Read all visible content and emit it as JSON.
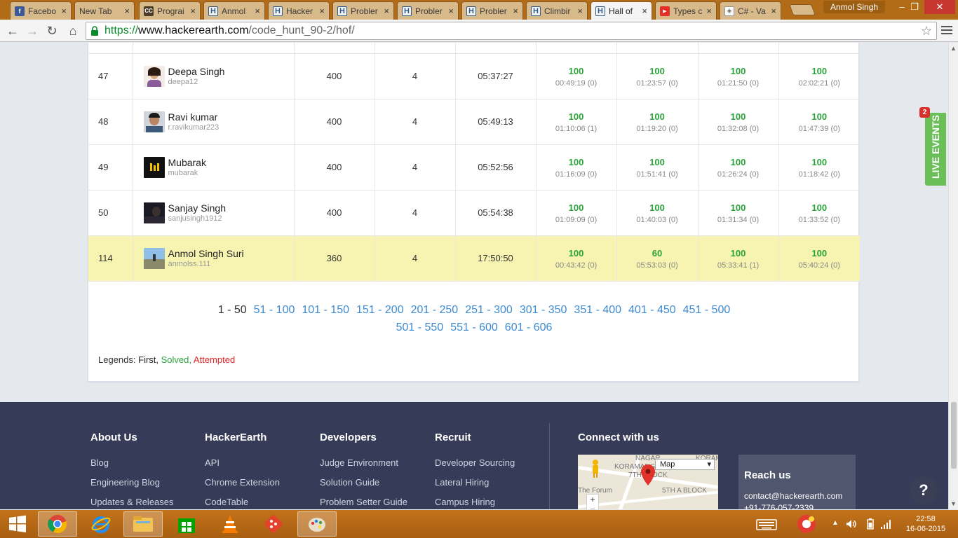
{
  "browser": {
    "tabs": [
      {
        "title": "Facebo",
        "favicon": "facebook-icon",
        "active": false
      },
      {
        "title": "New Tab",
        "favicon": "none",
        "active": false
      },
      {
        "title": "Prograi",
        "favicon": "cc-icon",
        "active": false
      },
      {
        "title": "Anmol",
        "favicon": "hackerearth-icon",
        "active": false
      },
      {
        "title": "Hacker",
        "favicon": "hackerearth-icon",
        "active": false
      },
      {
        "title": "Probler",
        "favicon": "hackerearth-icon",
        "active": false
      },
      {
        "title": "Probler",
        "favicon": "hackerearth-icon",
        "active": false
      },
      {
        "title": "Probler",
        "favicon": "hackerearth-icon",
        "active": false
      },
      {
        "title": "Climbir",
        "favicon": "hackerearth-icon",
        "active": false
      },
      {
        "title": "Hall of",
        "favicon": "hackerearth-icon",
        "active": true
      },
      {
        "title": "Types c",
        "favicon": "youtube-icon",
        "active": false
      },
      {
        "title": "C# - Va",
        "favicon": "csharp-icon",
        "active": false
      }
    ],
    "tab_close": "×",
    "profile_name": "Anmol Singh",
    "url_secure": "https://",
    "url_host": "www.hackerearth.com",
    "url_path": "/code_hunt_90-2/hof/",
    "nav": {
      "back": "←",
      "forward": "→",
      "reload": "↻",
      "home": "⌂"
    },
    "window": {
      "minimize": "–",
      "maximize": "❐",
      "close": "✕"
    },
    "star": "☆"
  },
  "leaderboard": {
    "rows": [
      {
        "rank": "47",
        "name": "Deepa Singh",
        "handle": "deepa12",
        "score": "400",
        "solved": "4",
        "time": "05:37:27",
        "problems": [
          {
            "score": "100",
            "time": "00:49:19 (0)"
          },
          {
            "score": "100",
            "time": "01:23:57 (0)"
          },
          {
            "score": "100",
            "time": "01:21:50 (0)"
          },
          {
            "score": "100",
            "time": "02:02:21 (0)"
          }
        ]
      },
      {
        "rank": "48",
        "name": "Ravi kumar",
        "handle": "r.ravikumar223",
        "score": "400",
        "solved": "4",
        "time": "05:49:13",
        "problems": [
          {
            "score": "100",
            "time": "01:10:06 (1)"
          },
          {
            "score": "100",
            "time": "01:19:20 (0)"
          },
          {
            "score": "100",
            "time": "01:32:08 (0)"
          },
          {
            "score": "100",
            "time": "01:47:39 (0)"
          }
        ]
      },
      {
        "rank": "49",
        "name": "Mubarak",
        "handle": "mubarak",
        "score": "400",
        "solved": "4",
        "time": "05:52:56",
        "problems": [
          {
            "score": "100",
            "time": "01:16:09 (0)"
          },
          {
            "score": "100",
            "time": "01:51:41 (0)"
          },
          {
            "score": "100",
            "time": "01:26:24 (0)"
          },
          {
            "score": "100",
            "time": "01:18:42 (0)"
          }
        ]
      },
      {
        "rank": "50",
        "name": "Sanjay Singh",
        "handle": "sanjusingh1912",
        "score": "400",
        "solved": "4",
        "time": "05:54:38",
        "problems": [
          {
            "score": "100",
            "time": "01:09:09 (0)"
          },
          {
            "score": "100",
            "time": "01:40:03 (0)"
          },
          {
            "score": "100",
            "time": "01:31:34 (0)"
          },
          {
            "score": "100",
            "time": "01:33:52 (0)"
          }
        ]
      },
      {
        "rank": "114",
        "name": "Anmol Singh Suri",
        "handle": "anmolss.111",
        "score": "360",
        "solved": "4",
        "time": "17:50:50",
        "problems": [
          {
            "score": "100",
            "time": "00:43:42 (0)"
          },
          {
            "score": "60",
            "time": "05:53:03 (0)"
          },
          {
            "score": "100",
            "time": "05:33:41 (1)"
          },
          {
            "score": "100",
            "time": "05:40:24 (0)"
          }
        ]
      }
    ],
    "pages": [
      "1 - 50",
      "51 - 100",
      "101 - 150",
      "151 - 200",
      "201 - 250",
      "251 - 300",
      "301 - 350",
      "351 - 400",
      "401 - 450",
      "451 - 500",
      "501 - 550",
      "551 - 600",
      "601 - 606"
    ],
    "legends": {
      "label": "Legends:",
      "first": "First,",
      "solved": "Solved,",
      "attempted": "Attempted"
    },
    "colors": {
      "solved": "#2aa33a",
      "attempted": "#e02424",
      "link": "#3d8ad0",
      "highlight": "#f6f4b0"
    }
  },
  "live_events": {
    "label": "LIVE EVENTS",
    "count": "2"
  },
  "footer": {
    "about": {
      "title": "About Us",
      "links": [
        "Blog",
        "Engineering Blog",
        "Updates & Releases"
      ]
    },
    "hackerearth": {
      "title": "HackerEarth",
      "links": [
        "API",
        "Chrome Extension",
        "CodeTable"
      ]
    },
    "developers": {
      "title": "Developers",
      "links": [
        "Judge Environment",
        "Solution Guide",
        "Problem Setter Guide"
      ]
    },
    "recruit": {
      "title": "Recruit",
      "links": [
        "Developer Sourcing",
        "Lateral Hiring",
        "Campus Hiring"
      ]
    },
    "connect_title": "Connect with us",
    "map": {
      "type_select": "Map",
      "labels": [
        "NAGAR",
        "KORAMANGALA",
        "7TH BLOCK",
        "The Forum",
        "5TH A BLOCK",
        "KORAMA"
      ],
      "zoom_in": "+",
      "zoom_out": "−"
    },
    "reach": {
      "title": "Reach us",
      "email": "contact@hackerearth.com",
      "phone": "+91-776-057-2339"
    },
    "help": "?"
  },
  "taskbar": {
    "time": "22:58",
    "date": "16-06-2015"
  }
}
